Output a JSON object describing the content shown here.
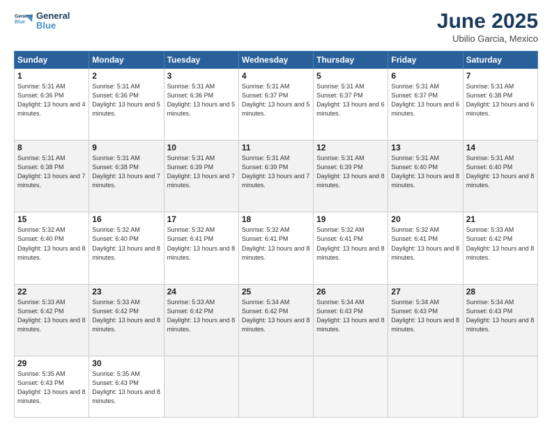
{
  "header": {
    "logo_line1": "General",
    "logo_line2": "Blue",
    "month": "June 2025",
    "location": "Ubilio Garcia, Mexico"
  },
  "weekdays": [
    "Sunday",
    "Monday",
    "Tuesday",
    "Wednesday",
    "Thursday",
    "Friday",
    "Saturday"
  ],
  "weeks": [
    [
      {
        "day": "1",
        "sunrise": "5:31 AM",
        "sunset": "6:36 PM",
        "daylight": "13 hours and 4 minutes."
      },
      {
        "day": "2",
        "sunrise": "5:31 AM",
        "sunset": "6:36 PM",
        "daylight": "13 hours and 5 minutes."
      },
      {
        "day": "3",
        "sunrise": "5:31 AM",
        "sunset": "6:36 PM",
        "daylight": "13 hours and 5 minutes."
      },
      {
        "day": "4",
        "sunrise": "5:31 AM",
        "sunset": "6:37 PM",
        "daylight": "13 hours and 5 minutes."
      },
      {
        "day": "5",
        "sunrise": "5:31 AM",
        "sunset": "6:37 PM",
        "daylight": "13 hours and 6 minutes."
      },
      {
        "day": "6",
        "sunrise": "5:31 AM",
        "sunset": "6:37 PM",
        "daylight": "13 hours and 6 minutes."
      },
      {
        "day": "7",
        "sunrise": "5:31 AM",
        "sunset": "6:38 PM",
        "daylight": "13 hours and 6 minutes."
      }
    ],
    [
      {
        "day": "8",
        "sunrise": "5:31 AM",
        "sunset": "6:38 PM",
        "daylight": "13 hours and 7 minutes."
      },
      {
        "day": "9",
        "sunrise": "5:31 AM",
        "sunset": "6:38 PM",
        "daylight": "13 hours and 7 minutes."
      },
      {
        "day": "10",
        "sunrise": "5:31 AM",
        "sunset": "6:39 PM",
        "daylight": "13 hours and 7 minutes."
      },
      {
        "day": "11",
        "sunrise": "5:31 AM",
        "sunset": "6:39 PM",
        "daylight": "13 hours and 7 minutes."
      },
      {
        "day": "12",
        "sunrise": "5:31 AM",
        "sunset": "6:39 PM",
        "daylight": "13 hours and 8 minutes."
      },
      {
        "day": "13",
        "sunrise": "5:31 AM",
        "sunset": "6:40 PM",
        "daylight": "13 hours and 8 minutes."
      },
      {
        "day": "14",
        "sunrise": "5:31 AM",
        "sunset": "6:40 PM",
        "daylight": "13 hours and 8 minutes."
      }
    ],
    [
      {
        "day": "15",
        "sunrise": "5:32 AM",
        "sunset": "6:40 PM",
        "daylight": "13 hours and 8 minutes."
      },
      {
        "day": "16",
        "sunrise": "5:32 AM",
        "sunset": "6:40 PM",
        "daylight": "13 hours and 8 minutes."
      },
      {
        "day": "17",
        "sunrise": "5:32 AM",
        "sunset": "6:41 PM",
        "daylight": "13 hours and 8 minutes."
      },
      {
        "day": "18",
        "sunrise": "5:32 AM",
        "sunset": "6:41 PM",
        "daylight": "13 hours and 8 minutes."
      },
      {
        "day": "19",
        "sunrise": "5:32 AM",
        "sunset": "6:41 PM",
        "daylight": "13 hours and 8 minutes."
      },
      {
        "day": "20",
        "sunrise": "5:32 AM",
        "sunset": "6:41 PM",
        "daylight": "13 hours and 8 minutes."
      },
      {
        "day": "21",
        "sunrise": "5:33 AM",
        "sunset": "6:42 PM",
        "daylight": "13 hours and 8 minutes."
      }
    ],
    [
      {
        "day": "22",
        "sunrise": "5:33 AM",
        "sunset": "6:42 PM",
        "daylight": "13 hours and 8 minutes."
      },
      {
        "day": "23",
        "sunrise": "5:33 AM",
        "sunset": "6:42 PM",
        "daylight": "13 hours and 8 minutes."
      },
      {
        "day": "24",
        "sunrise": "5:33 AM",
        "sunset": "6:42 PM",
        "daylight": "13 hours and 8 minutes."
      },
      {
        "day": "25",
        "sunrise": "5:34 AM",
        "sunset": "6:42 PM",
        "daylight": "13 hours and 8 minutes."
      },
      {
        "day": "26",
        "sunrise": "5:34 AM",
        "sunset": "6:43 PM",
        "daylight": "13 hours and 8 minutes."
      },
      {
        "day": "27",
        "sunrise": "5:34 AM",
        "sunset": "6:43 PM",
        "daylight": "13 hours and 8 minutes."
      },
      {
        "day": "28",
        "sunrise": "5:34 AM",
        "sunset": "6:43 PM",
        "daylight": "13 hours and 8 minutes."
      }
    ],
    [
      {
        "day": "29",
        "sunrise": "5:35 AM",
        "sunset": "6:43 PM",
        "daylight": "13 hours and 8 minutes."
      },
      {
        "day": "30",
        "sunrise": "5:35 AM",
        "sunset": "6:43 PM",
        "daylight": "13 hours and 8 minutes."
      },
      null,
      null,
      null,
      null,
      null
    ]
  ]
}
